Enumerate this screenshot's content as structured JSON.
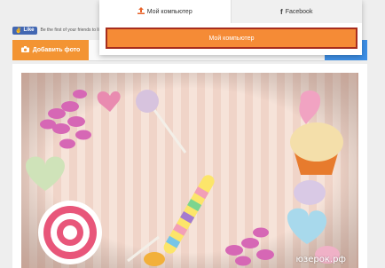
{
  "facebook_like": {
    "button_label": "Like",
    "text": "Be the first of your friends to like this."
  },
  "toolbar": {
    "add_photo_label": "Добавить фото"
  },
  "upload_panel": {
    "tabs": [
      {
        "label": "Мой компьютер",
        "icon": "upload-icon",
        "active": true
      },
      {
        "label": "Facebook",
        "icon": "facebook-icon",
        "active": false
      }
    ],
    "upload_button_label": "Мой компьютер"
  },
  "photo": {
    "description_icon": "candy-photo",
    "watermark": "юзерок.рф"
  },
  "colors": {
    "accent_orange": "#f58b36",
    "accent_blue": "#3d8fe6",
    "facebook_blue": "#4267b2"
  }
}
